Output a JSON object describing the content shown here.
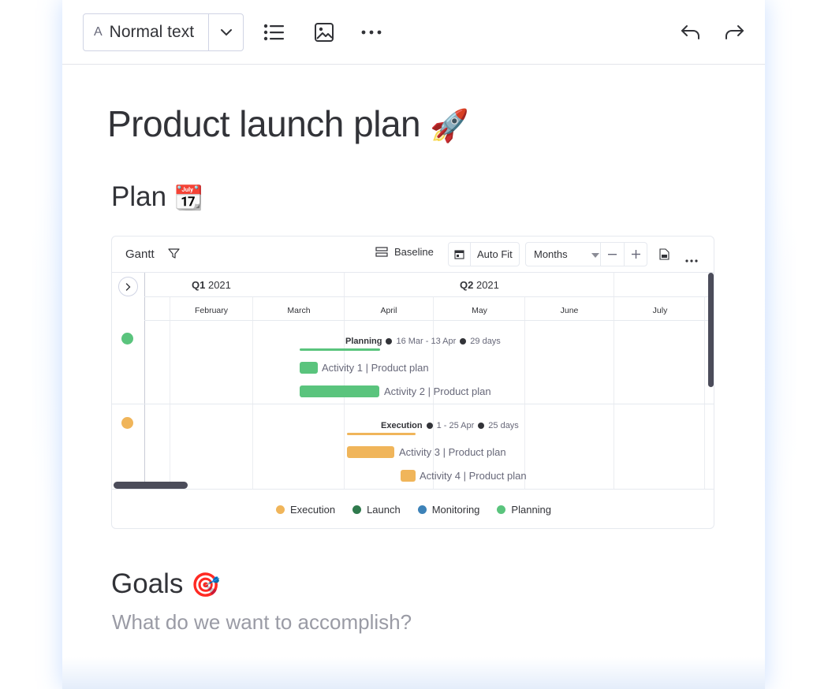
{
  "toolbar": {
    "format_prefix": "A",
    "format_label": "Normal text"
  },
  "doc": {
    "title": "Product launch plan",
    "title_emoji": "🚀",
    "plan_heading": "Plan",
    "plan_emoji": "📆",
    "goals_heading": "Goals",
    "goals_emoji": "🎯",
    "goals_placeholder": "What do we want to accomplish?"
  },
  "gantt": {
    "title": "Gantt",
    "baseline_label": "Baseline",
    "autofit_label": "Auto Fit",
    "scale_label": "Months",
    "quarters": [
      {
        "q": "Q1",
        "year": "2021"
      },
      {
        "q": "Q2",
        "year": "2021"
      }
    ],
    "months": [
      "February",
      "March",
      "April",
      "May",
      "June",
      "July"
    ],
    "groups": [
      {
        "name": "Planning",
        "range": "16 Mar - 13 Apr",
        "duration": "29 days",
        "color": "#5ac47d",
        "items": [
          "Activity 1 | Product plan",
          "Activity 2 | Product plan"
        ]
      },
      {
        "name": "Execution",
        "range": "1 - 25 Apr",
        "duration": "25 days",
        "color": "#f0b55a",
        "items": [
          "Activity 3 | Product plan",
          "Activity 4 | Product plan"
        ]
      }
    ],
    "legend": [
      {
        "label": "Execution",
        "color": "#f0b55a"
      },
      {
        "label": "Launch",
        "color": "#2f7a4d"
      },
      {
        "label": "Monitoring",
        "color": "#3d82b8"
      },
      {
        "label": "Planning",
        "color": "#5ac47d"
      }
    ]
  },
  "colors": {
    "accent": "#323338",
    "scrollbar": "#4b4c5a"
  }
}
